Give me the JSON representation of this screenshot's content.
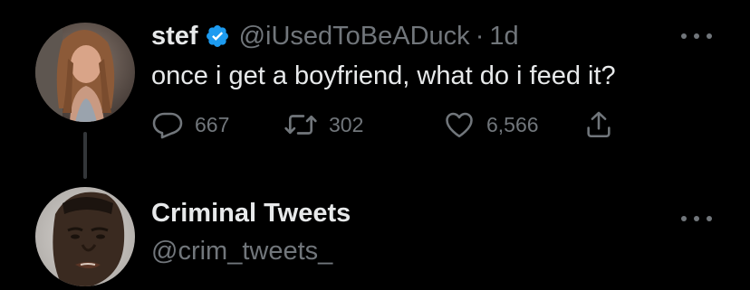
{
  "tweet": {
    "display_name": "stef",
    "verified_icon": "verified-badge-icon",
    "handle": "@iUsedToBeADuck",
    "separator": "·",
    "time": "1d",
    "text": "once i get a boyfriend, what do i feed it?",
    "replies": "667",
    "retweets": "302",
    "likes": "6,566",
    "more_icon": "more-options-icon"
  },
  "reply_account": {
    "display_name": "Criminal Tweets",
    "handle": "@crim_tweets_",
    "more_icon": "more-options-icon"
  },
  "colors": {
    "background": "#000000",
    "primary_text": "#e7e9ea",
    "secondary_text": "#71767b",
    "verified_blue": "#1d9bf0",
    "thread_line": "#333639"
  }
}
